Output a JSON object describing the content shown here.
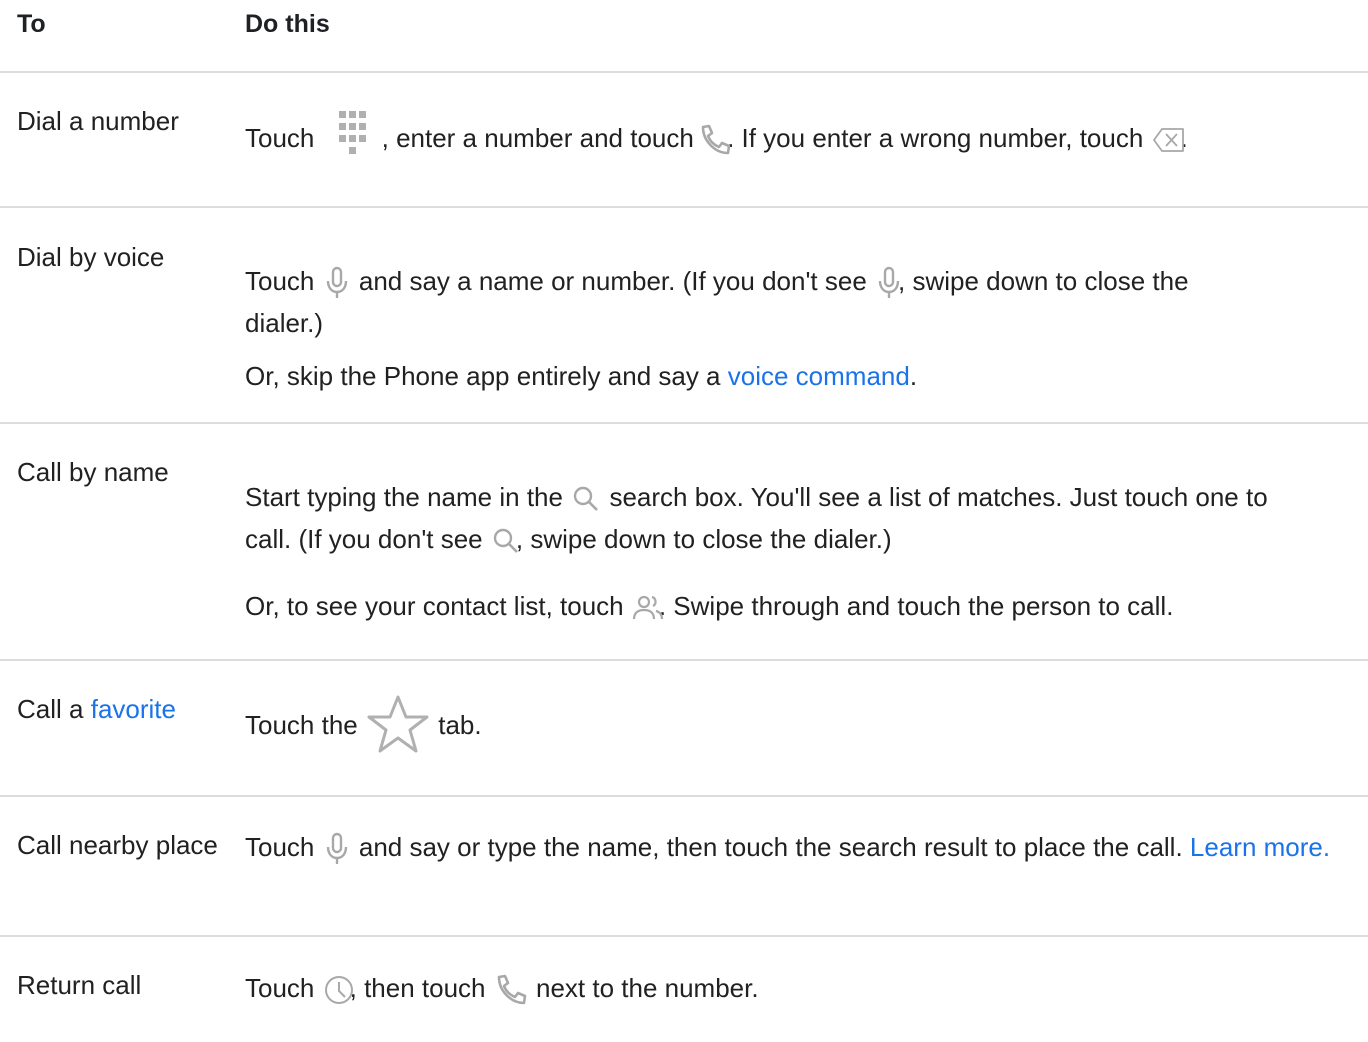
{
  "header": {
    "col_to": "To",
    "col_do": "Do this"
  },
  "rows": [
    {
      "to": "Dial a number",
      "p1": {
        "t1": "Touch",
        "t2": ", enter a number and touch",
        "t3": ". If you enter a wrong number, touch",
        "t4": "."
      }
    },
    {
      "to": "Dial by voice",
      "p1": {
        "t1": "Touch",
        "t2": "and say a name or number. (If you don't see",
        "t3": ", swipe down to close the",
        "t4": "dialer.)"
      },
      "p2": {
        "t1": "Or, skip the Phone app entirely and say a",
        "link": "voice command",
        "t2": "."
      }
    },
    {
      "to": "Call by name",
      "p1": {
        "t1": "Start typing the name in the",
        "t2": "search box. You'll see a list of matches. Just touch one to",
        "t3": "call. (If you don't see",
        "t4": ", swipe down to close the dialer.)"
      },
      "p2": {
        "t1": "Or, to see your contact list, touch",
        "t2": ". Swipe through and touch the person to call."
      }
    },
    {
      "to_prefix": "Call a",
      "to_link": "favorite",
      "p1": {
        "t1": "Touch the",
        "t2": "tab."
      }
    },
    {
      "to": "Call nearby place",
      "p1": {
        "t1": "Touch",
        "t2": "and say or type the name, then touch the search result to place the call.",
        "link": "Learn more."
      }
    },
    {
      "to": "Return call",
      "p1": {
        "t1": "Touch",
        "t2": ", then touch",
        "t3": "next to the number."
      }
    }
  ],
  "colors": {
    "link": "#1a73e8",
    "rule": "#dadce0",
    "icon": "#9e9e9e"
  }
}
